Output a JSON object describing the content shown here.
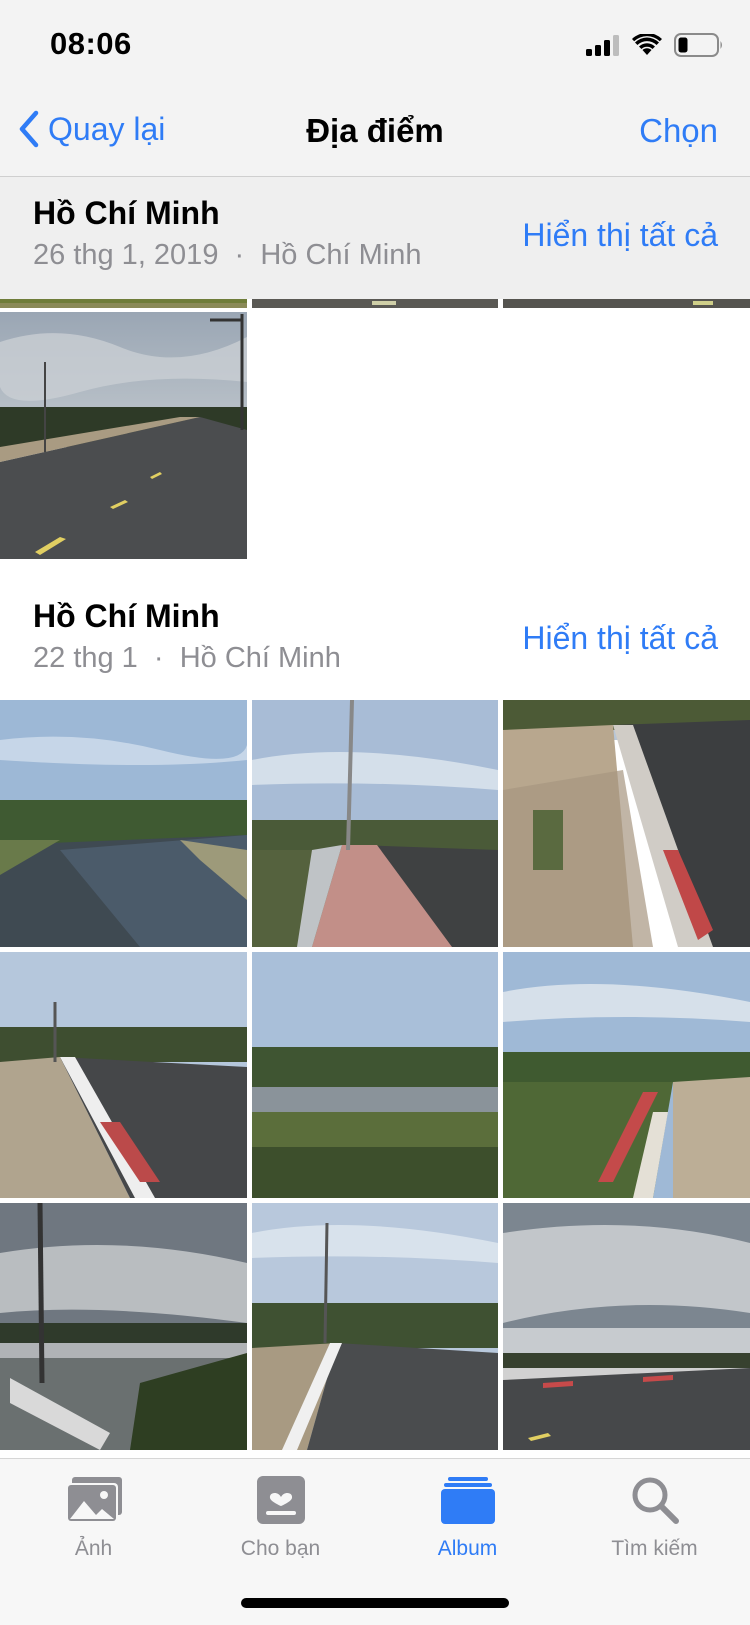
{
  "status": {
    "time": "08:06"
  },
  "nav": {
    "back_label": "Quay lại",
    "title": "Địa điểm",
    "select_label": "Chọn"
  },
  "sections": [
    {
      "title": "Hồ Chí Minh",
      "subtitle": "26 thg 1, 2019  ·  Hồ Chí Minh",
      "action": "Hiển thị tất cả"
    },
    {
      "title": "Hồ Chí Minh",
      "subtitle": "22 thg 1  ·  Hồ Chí Minh",
      "action": "Hiển thị tất cả"
    }
  ],
  "tabs": [
    {
      "label": "Ảnh",
      "icon": "photos-icon"
    },
    {
      "label": "Cho bạn",
      "icon": "for-you-icon"
    },
    {
      "label": "Album",
      "icon": "albums-icon",
      "active": true
    },
    {
      "label": "Tìm kiếm",
      "icon": "search-icon"
    }
  ],
  "colors": {
    "accent": "#2f7cf6",
    "inactive": "#8e8e93"
  }
}
